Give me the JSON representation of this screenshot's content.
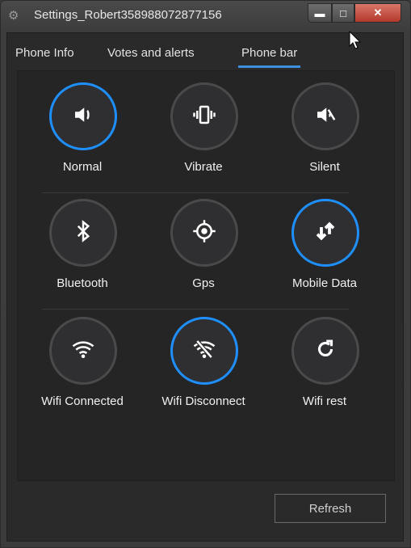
{
  "window": {
    "title": "Settings_Robert358988072877156",
    "controls": {
      "minimize": "▬",
      "maximize": "□",
      "close": "✕"
    }
  },
  "tabs": [
    {
      "label": "Phone Info",
      "active": false
    },
    {
      "label": "Votes and alerts",
      "active": false
    },
    {
      "label": "Phone bar",
      "active": true
    }
  ],
  "toggles": [
    {
      "label": "Normal",
      "icon": "speaker-icon",
      "active": true
    },
    {
      "label": "Vibrate",
      "icon": "vibrate-icon",
      "active": false
    },
    {
      "label": "Silent",
      "icon": "mute-icon",
      "active": false
    },
    {
      "label": "Bluetooth",
      "icon": "bluetooth-icon",
      "active": false
    },
    {
      "label": "Gps",
      "icon": "gps-icon",
      "active": false
    },
    {
      "label": "Mobile Data",
      "icon": "mobile-data-icon",
      "active": true
    },
    {
      "label": "Wifi Connected",
      "icon": "wifi-icon",
      "active": false
    },
    {
      "label": "Wifi Disconnect",
      "icon": "wifi-off-icon",
      "active": true
    },
    {
      "label": "Wifi rest",
      "icon": "refresh-icon",
      "active": false
    }
  ],
  "footer": {
    "refresh_label": "Refresh"
  },
  "colors": {
    "accent": "#1f8fff",
    "tab_underline": "#3d8fe0"
  }
}
